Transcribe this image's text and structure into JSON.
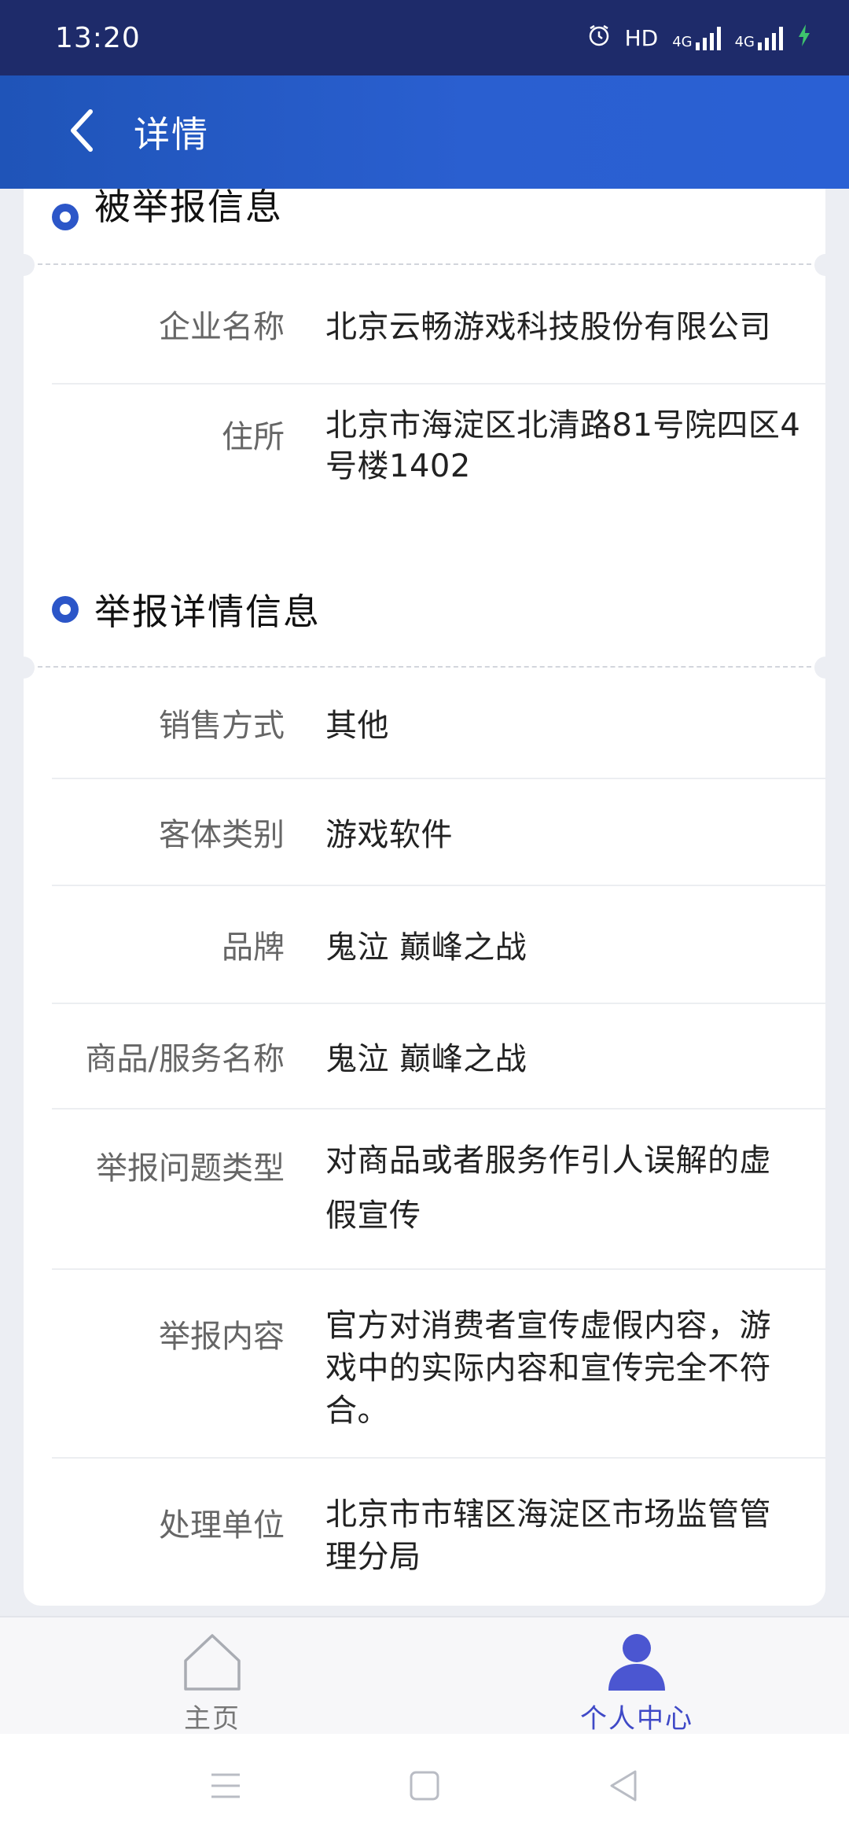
{
  "status_bar": {
    "time": "13:20",
    "hd": "HD",
    "net1": "4G",
    "net2": "4G"
  },
  "header": {
    "title": "详情"
  },
  "reported_info": {
    "title": "被举报信息",
    "rows": [
      {
        "label": "企业名称",
        "value": "北京云畅游戏科技股份有限公司"
      },
      {
        "label": "住所",
        "value": "北京市海淀区北清路81号院四区4号楼1402"
      }
    ]
  },
  "report_details": {
    "title": "举报详情信息",
    "rows": [
      {
        "label": "销售方式",
        "value": "其他"
      },
      {
        "label": "客体类别",
        "value": "游戏软件"
      },
      {
        "label": "品牌",
        "value": "鬼泣 巅峰之战"
      },
      {
        "label": "商品/服务名称",
        "value": "鬼泣 巅峰之战"
      },
      {
        "label": "举报问题类型",
        "value": "对商品或者服务作引人误解的虚假宣传"
      },
      {
        "label": "举报内容",
        "value": "官方对消费者宣传虚假内容，游戏中的实际内容和宣传完全不符合。"
      },
      {
        "label": "处理单位",
        "value": "北京市市辖区海淀区市场监管管理分局"
      }
    ]
  },
  "bottom_nav": {
    "home": "主页",
    "profile": "个人中心"
  },
  "colors": {
    "accent": "#2c56c8",
    "header_start": "#1f54b8",
    "status_bar": "#1e2b6a",
    "active_tab": "#3f49c7"
  },
  "icons": {
    "back": "chevron-left-icon",
    "home": "home-icon",
    "profile": "person-icon"
  }
}
